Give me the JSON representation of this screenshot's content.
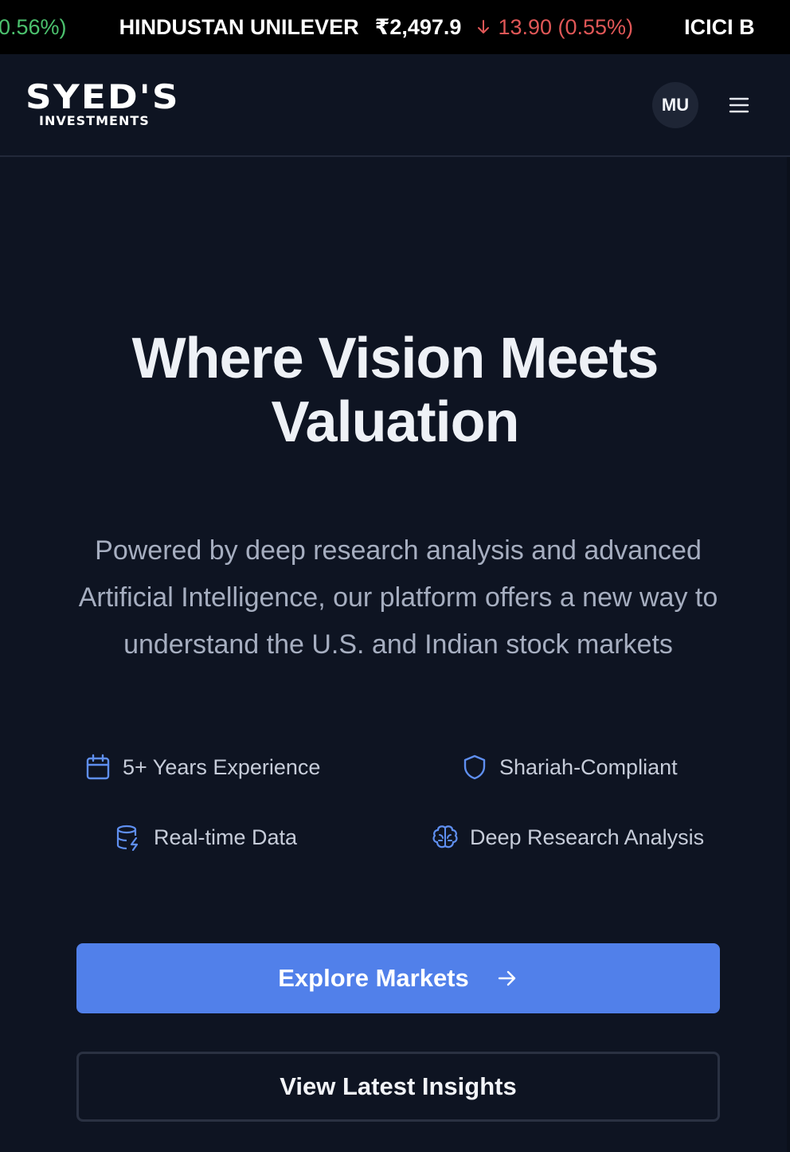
{
  "ticker": {
    "items": [
      {
        "change_tail": "0.56%)",
        "direction": "up"
      },
      {
        "name": "HINDUSTAN UNILEVER",
        "price": "₹2,497.9",
        "change": "13.90 (0.55%)",
        "direction": "down"
      },
      {
        "name": "ICICI B"
      }
    ]
  },
  "header": {
    "logo_main": "SYED'S",
    "logo_sub": "INVESTMENTS",
    "avatar_initials": "MU"
  },
  "hero": {
    "title_line1": "Where Vision Meets",
    "title_line2": "Valuation",
    "subtitle": "Powered by deep research analysis and advanced Artificial Intelligence, our platform offers a new way to understand the U.S. and Indian stock markets"
  },
  "features": [
    {
      "label": "5+ Years Experience",
      "icon": "calendar-icon"
    },
    {
      "label": "Shariah-Compliant",
      "icon": "shield-icon"
    },
    {
      "label": "Real-time Data",
      "icon": "database-zap-icon"
    },
    {
      "label": "Deep Research Analysis",
      "icon": "brain-icon"
    }
  ],
  "actions": {
    "primary_label": "Explore Markets",
    "secondary_label": "View Latest Insights"
  },
  "colors": {
    "background": "#0e1422",
    "ticker_bg": "#000000",
    "accent": "#5180ea",
    "up": "#4cc26e",
    "down": "#e05757",
    "icon_blue": "#5f8ff0"
  }
}
